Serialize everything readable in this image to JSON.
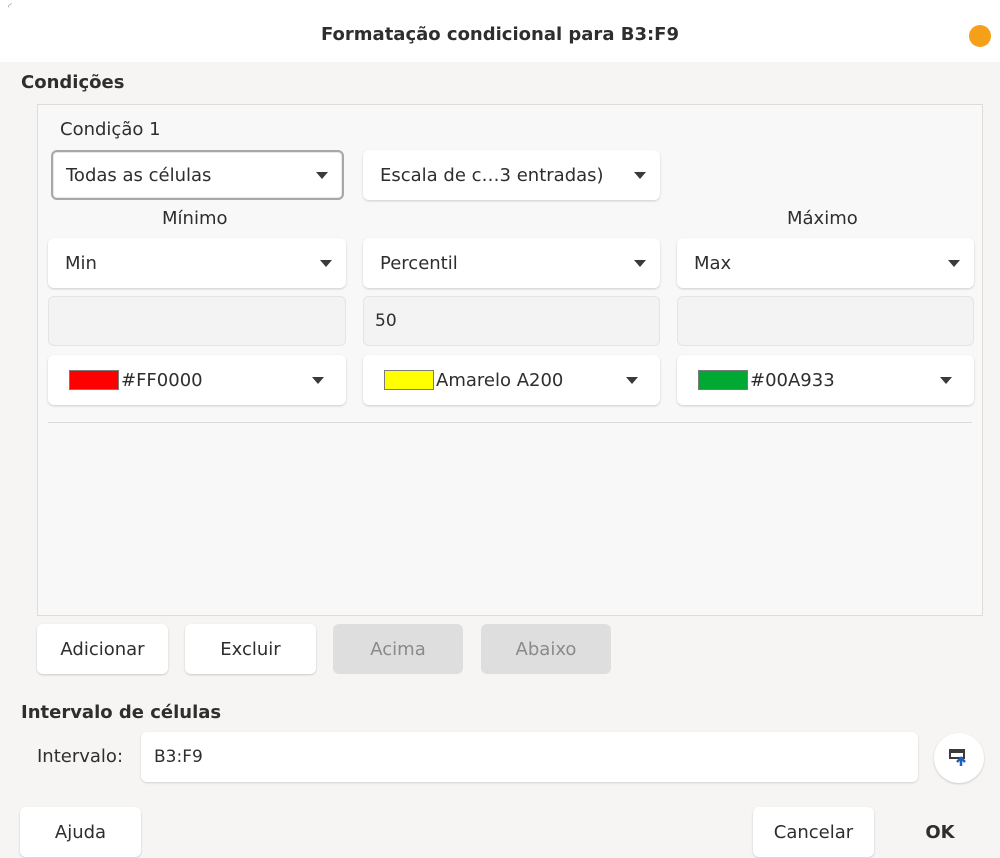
{
  "window": {
    "title": "Formatação condicional para B3:F9"
  },
  "conditions": {
    "section_title": "Condições",
    "condition_label": "Condição 1",
    "apply_to": "Todas as células",
    "style_type": "Escala de c…3 entradas)",
    "columns": {
      "min_heading": "Mínimo",
      "max_heading": "Máximo"
    },
    "min": {
      "type": "Min",
      "value": "",
      "color_label": "#FF0000",
      "color": "#FF0000"
    },
    "mid": {
      "type": "Percentil",
      "value": "50",
      "color_label": "Amarelo A200",
      "color": "#FFFF00"
    },
    "max": {
      "type": "Max",
      "value": "",
      "color_label": "#00A933",
      "color": "#00A933"
    }
  },
  "actions": {
    "add": "Adicionar",
    "remove": "Excluir",
    "up": "Acima",
    "down": "Abaixo"
  },
  "range": {
    "section_title": "Intervalo de células",
    "label": "Intervalo:",
    "value": "B3:F9"
  },
  "footer": {
    "help": "Ajuda",
    "cancel": "Cancelar",
    "ok": "OK"
  }
}
